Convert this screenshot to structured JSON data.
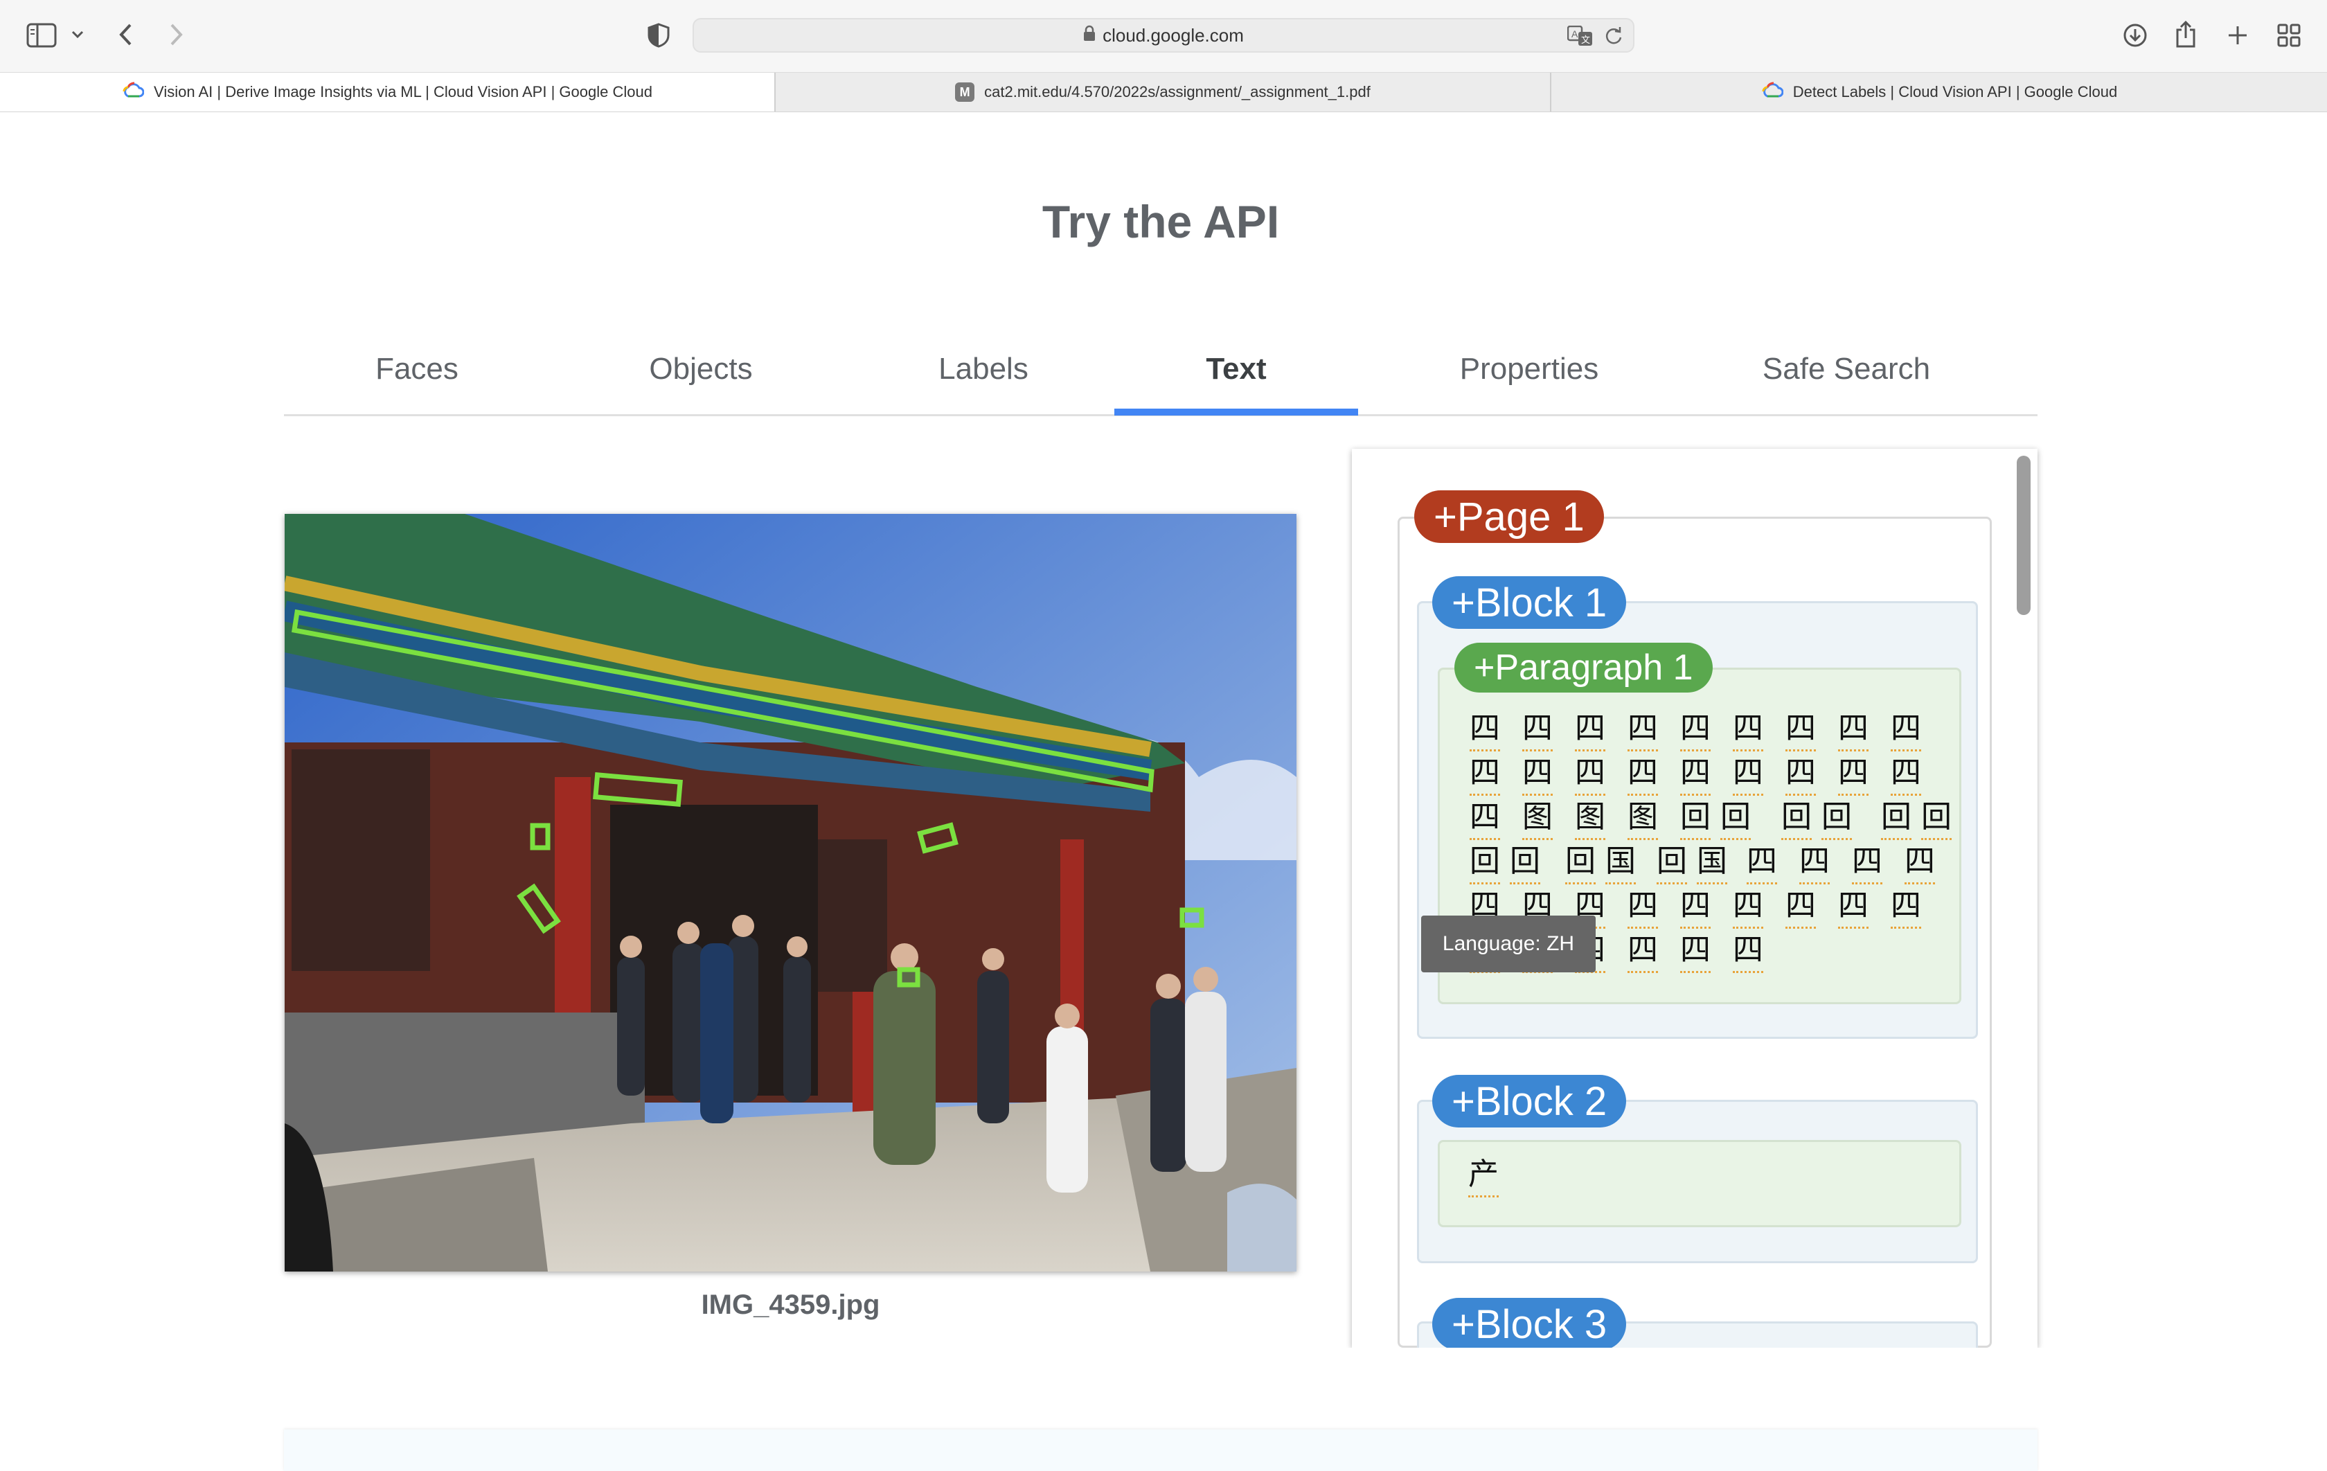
{
  "browser": {
    "url": "cloud.google.com",
    "tabs": [
      {
        "title": "Vision AI | Derive Image Insights via ML  |  Cloud Vision API  |  Google Cloud",
        "icon": "google-cloud-icon"
      },
      {
        "title": "cat2.mit.edu/4.570/2022s/assignment/_assignment_1.pdf",
        "icon": "m-letter-icon",
        "favicon_letter": "M"
      },
      {
        "title": "Detect Labels  |  Cloud Vision API  |  Google Cloud",
        "icon": "google-cloud-icon"
      }
    ]
  },
  "page": {
    "title": "Try the API",
    "tabs": [
      "Faces",
      "Objects",
      "Labels",
      "Text",
      "Properties",
      "Safe Search"
    ],
    "active_tab": "Text",
    "image_filename": "IMG_4359.jpg",
    "accent_color": "#4285f4"
  },
  "results": {
    "page_chip": "+Page 1",
    "blocks": [
      {
        "label": "+Block 1",
        "paragraph": "+Paragraph 1"
      },
      {
        "label": "+Block 2",
        "symbols": [
          "产"
        ]
      },
      {
        "label": "+Block 3"
      }
    ],
    "block1_rows": [
      [
        "四",
        "四",
        "四",
        "四",
        "四",
        "四",
        "四",
        "四",
        "四"
      ],
      [
        "四",
        "四",
        "四",
        "四",
        "四",
        "四",
        "四",
        "四",
        "四"
      ],
      [
        "四",
        "图",
        "图",
        "图",
        "回",
        "回",
        "回",
        "回",
        "回",
        "回"
      ],
      [
        "回",
        "回",
        "回",
        "国",
        "回",
        "国",
        "四",
        "四",
        "四",
        "四"
      ],
      [
        "四",
        "四",
        "四",
        "四",
        "四",
        "四",
        "四",
        "四",
        "四"
      ],
      [
        "四",
        "四",
        "四",
        "四",
        "四",
        "四"
      ]
    ],
    "tooltip": "Language: ZH",
    "colors": {
      "page": "#b23c1f",
      "block": "#3c87d3",
      "paragraph": "#5aa84e"
    }
  }
}
